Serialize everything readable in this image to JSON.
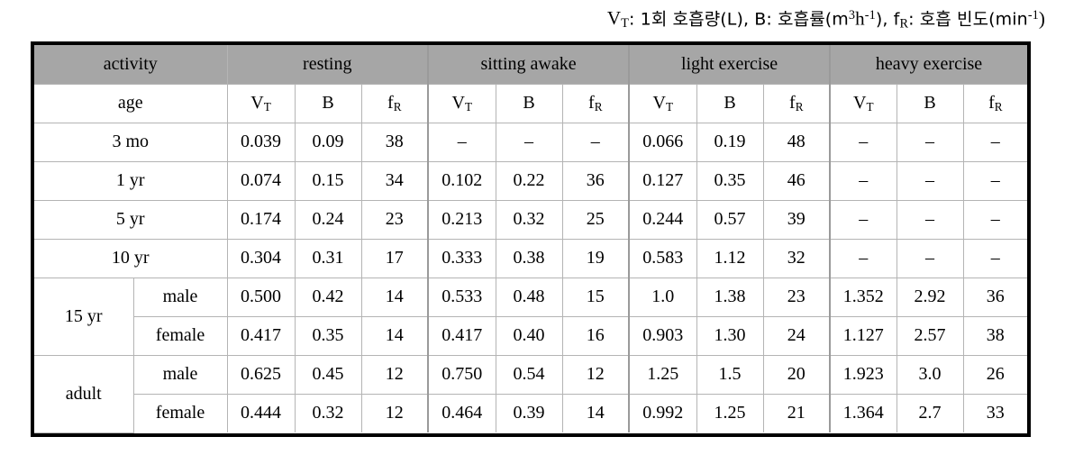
{
  "caption": {
    "vt_sym": "V",
    "vt_sub": "T",
    "vt_text": ": 1회 호흡량(L), B: 호흡률(m",
    "b_sup1": "3",
    "b_mid": "h",
    "b_sup2": "-1",
    "b_tail": "), f",
    "fr_sub": "R",
    "fr_text": ": 호흡 빈도(min",
    "fr_sup": "-1",
    "fr_close": ")",
    "full_text": "VT: 1회 호흡량(L), B: 호흡률(m3h-1), fR: 호흡 빈도(min-1)"
  },
  "colors": {
    "header_gray": "#a6a6a6",
    "frame_black": "#000000",
    "grid_gray": "#b4b4b4"
  },
  "table": {
    "header_rows": {
      "activity_label": "activity",
      "age_label": "age",
      "groups": [
        {
          "label": "resting",
          "span": 3
        },
        {
          "label": "sitting awake",
          "span": 3
        },
        {
          "label": "light exercise",
          "span": 3
        },
        {
          "label": "heavy exercise",
          "span": 3
        }
      ],
      "metrics": [
        "V_T",
        "B",
        "f_R"
      ],
      "metric_labels": {
        "vt_main": "V",
        "vt_sub": "T",
        "b_main": "B",
        "fr_main": "f",
        "fr_sub": "R"
      }
    },
    "rows": [
      {
        "age": "3 mo",
        "sex": null,
        "agespan": 1,
        "values": [
          "0.039",
          "0.09",
          "38",
          "–",
          "–",
          "–",
          "0.066",
          "0.19",
          "48",
          "–",
          "–",
          "–"
        ]
      },
      {
        "age": "1 yr",
        "sex": null,
        "agespan": 1,
        "values": [
          "0.074",
          "0.15",
          "34",
          "0.102",
          "0.22",
          "36",
          "0.127",
          "0.35",
          "46",
          "–",
          "–",
          "–"
        ]
      },
      {
        "age": "5 yr",
        "sex": null,
        "agespan": 1,
        "values": [
          "0.174",
          "0.24",
          "23",
          "0.213",
          "0.32",
          "25",
          "0.244",
          "0.57",
          "39",
          "–",
          "–",
          "–"
        ]
      },
      {
        "age": "10 yr",
        "sex": null,
        "agespan": 1,
        "values": [
          "0.304",
          "0.31",
          "17",
          "0.333",
          "0.38",
          "19",
          "0.583",
          "1.12",
          "32",
          "–",
          "–",
          "–"
        ]
      },
      {
        "age": "15 yr",
        "sex": "male",
        "agespan": 2,
        "values": [
          "0.500",
          "0.42",
          "14",
          "0.533",
          "0.48",
          "15",
          "1.0",
          "1.38",
          "23",
          "1.352",
          "2.92",
          "36"
        ]
      },
      {
        "age": null,
        "sex": "female",
        "agespan": 0,
        "values": [
          "0.417",
          "0.35",
          "14",
          "0.417",
          "0.40",
          "16",
          "0.903",
          "1.30",
          "24",
          "1.127",
          "2.57",
          "38"
        ]
      },
      {
        "age": "adult",
        "sex": "male",
        "agespan": 2,
        "values": [
          "0.625",
          "0.45",
          "12",
          "0.750",
          "0.54",
          "12",
          "1.25",
          "1.5",
          "20",
          "1.923",
          "3.0",
          "26"
        ]
      },
      {
        "age": null,
        "sex": "female",
        "agespan": 0,
        "values": [
          "0.444",
          "0.32",
          "12",
          "0.464",
          "0.39",
          "14",
          "0.992",
          "1.25",
          "21",
          "1.364",
          "2.7",
          "33"
        ]
      }
    ]
  }
}
